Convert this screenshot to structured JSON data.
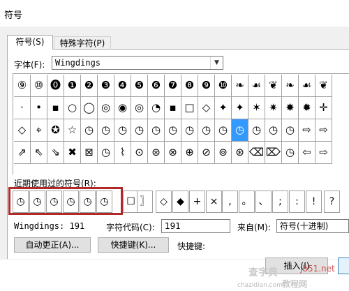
{
  "window": {
    "title": "符号"
  },
  "tabs": [
    {
      "label": "符号(S)"
    },
    {
      "label": "特殊字符(P)"
    }
  ],
  "font": {
    "label": "字体(F):",
    "value": "Wingdings"
  },
  "symbols": {
    "rows": [
      [
        "⑨",
        "⑩",
        "⓿",
        "❶",
        "❷",
        "❸",
        "❹",
        "❺",
        "❻",
        "❼",
        "❽",
        "❾",
        "❿",
        "❧",
        "☙",
        "❦",
        "❧",
        "☙",
        "❦"
      ],
      [
        "·",
        "•",
        "▪",
        "○",
        "◯",
        "◎",
        "◉",
        "◎",
        "◔",
        "▪",
        "□",
        "◇",
        "✦",
        "✦",
        "✶",
        "✷",
        "✸",
        "✹",
        "✛"
      ],
      [
        "◇",
        "⌖",
        "✪",
        "☆",
        "◷",
        "◷",
        "◷",
        "◷",
        "◷",
        "◷",
        "◷",
        "◷",
        "◷",
        "◷",
        "◷",
        "◷",
        "◷",
        "⇨",
        "⇨"
      ],
      [
        "⇗",
        "⇖",
        "⇘",
        "✖",
        "⊠",
        "◷",
        "⌇",
        "⊙",
        "⊛",
        "⊗",
        "⊕",
        "⊘",
        "⊚",
        "⊛",
        "⌫",
        "⌦",
        "◷",
        "⇦",
        "⇨"
      ]
    ],
    "selected": {
      "row": 2,
      "col": 13
    }
  },
  "recent": {
    "label": "近期使用过的符号(R):",
    "items": [
      "◷",
      "◷",
      "◷",
      "◷",
      "◷",
      "◷",
      "☐",
      "〗",
      "◇",
      "◆",
      "+",
      "×",
      ",",
      "。",
      "、",
      ";",
      ":",
      "!",
      "?"
    ]
  },
  "info": {
    "font_code": "Wingdings: 191",
    "char_code_label": "字符代码(C):",
    "char_code_value": "191",
    "from_label": "来自(M):",
    "from_value": "符号(十进制)"
  },
  "buttons": {
    "autocorrect": "自动更正(A)...",
    "shortcut_key": "快捷键(K)...",
    "shortcut_label": "快捷键:",
    "insert": "插入(I)"
  },
  "watermark": {
    "line1": "查字典",
    "line2": "教程网",
    "line3": "chazidian.com",
    "site": "jb51.net"
  }
}
